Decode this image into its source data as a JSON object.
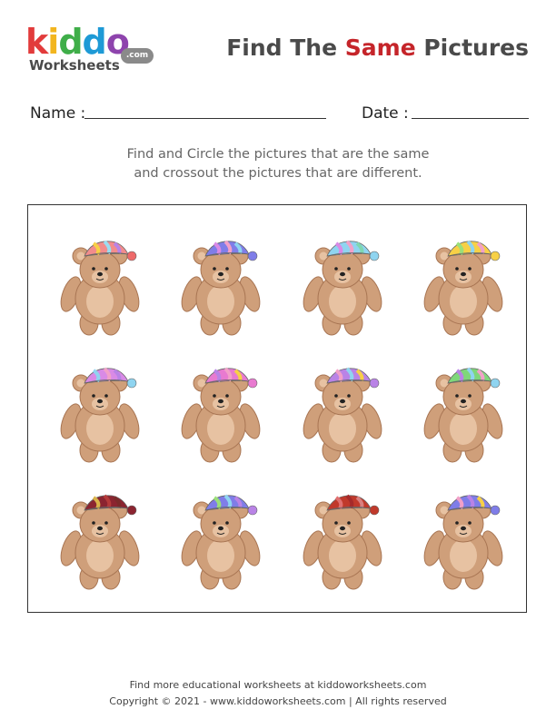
{
  "logo": {
    "letters": [
      {
        "ch": "k",
        "color": "#e23b3b"
      },
      {
        "ch": "i",
        "color": "#f2b51f"
      },
      {
        "ch": "d",
        "color": "#3fae49"
      },
      {
        "ch": "d",
        "color": "#1e9ad6"
      },
      {
        "ch": "o",
        "color": "#8e44ad"
      }
    ],
    "subtitle": "Worksheets",
    "tld": ".com"
  },
  "header": {
    "title_part1": "Find The ",
    "title_accent": "Same",
    "title_part2": " Pictures"
  },
  "form": {
    "name_label": "Name :",
    "date_label": "Date :"
  },
  "instructions": {
    "line1": "Find and Circle the pictures that are the same",
    "line2": "and crossout the pictures that are different."
  },
  "bears": [
    {
      "hat": [
        "#f28c8c",
        "#f7d046",
        "#9bdcf0",
        "#b983e6"
      ],
      "pom": "#ee6a6a"
    },
    {
      "hat": [
        "#7f7de8",
        "#d98ae6",
        "#f2a0c8",
        "#8fd4f0"
      ],
      "pom": "#7f7de8"
    },
    {
      "hat": [
        "#8fd4f0",
        "#d98ae6",
        "#f2a0c8",
        "#7fd7b0"
      ],
      "pom": "#8fd4f0"
    },
    {
      "hat": [
        "#f7d046",
        "#9be07a",
        "#8fd4f0",
        "#f2a0c8"
      ],
      "pom": "#f7d046"
    },
    {
      "hat": [
        "#d98ae6",
        "#8fd4f0",
        "#f2a0c8",
        "#b983e6"
      ],
      "pom": "#8fd4f0"
    },
    {
      "hat": [
        "#e87ad0",
        "#b983e6",
        "#f2a0c8",
        "#f7d046"
      ],
      "pom": "#e87ad0"
    },
    {
      "hat": [
        "#b983e6",
        "#f2a0c8",
        "#8fd4f0",
        "#f7d046"
      ],
      "pom": "#b983e6"
    },
    {
      "hat": [
        "#7fd77a",
        "#b983e6",
        "#8fd4f0",
        "#f2a0c8"
      ],
      "pom": "#8fd4f0"
    },
    {
      "hat": [
        "#8b2430",
        "#d9b24a",
        "#b43a3a",
        "#7a2a2a"
      ],
      "pom": "#8b2430"
    },
    {
      "hat": [
        "#7f7de8",
        "#9be07a",
        "#8fd4f0",
        "#b983e6"
      ],
      "pom": "#b983e6"
    },
    {
      "hat": [
        "#c0392b",
        "#e07070",
        "#a52a2a",
        "#d98080"
      ],
      "pom": "#c0392b"
    },
    {
      "hat": [
        "#7f7de8",
        "#f2a0c8",
        "#b983e6",
        "#f7d046"
      ],
      "pom": "#7f7de8"
    }
  ],
  "footer": {
    "line1": "Find more educational worksheets at kiddoworksheets.com",
    "line2": "Copyright © 2021 - www.kiddoworksheets.com  |  All rights reserved"
  }
}
